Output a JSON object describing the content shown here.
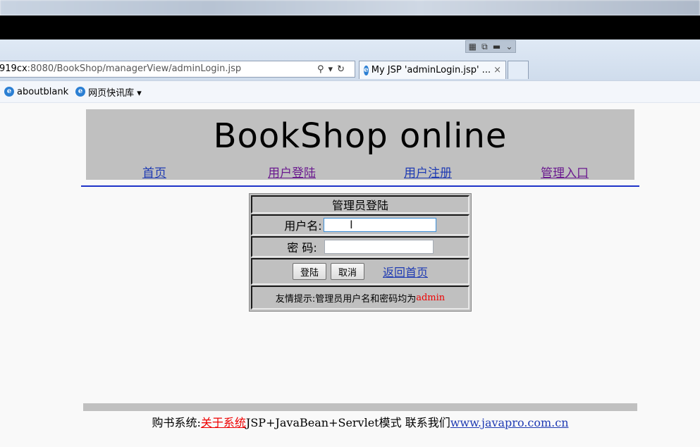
{
  "browser": {
    "address": "919cx:8080/BookShop/managerView/adminLogin.jsp",
    "address_host": "919cx",
    "address_rest": ":8080/BookShop/managerView/adminLogin.jsp",
    "tab_title": "My JSP 'adminLogin.jsp' ...",
    "tab_close": "×",
    "search_glyph": "⚲",
    "refresh_glyph": "↻",
    "favorites": [
      {
        "label": "aboutblank"
      },
      {
        "label": "网页快讯库 ▾"
      }
    ]
  },
  "site": {
    "title": "BookShop online",
    "nav": [
      {
        "label": "首页"
      },
      {
        "label": "用户登陆"
      },
      {
        "label": "用户注册"
      },
      {
        "label": "管理入口"
      }
    ]
  },
  "login": {
    "heading": "管理员登陆",
    "username_label": "用户名:",
    "username_value": "",
    "password_label": "密 码:",
    "password_value": "",
    "submit_label": "登陆",
    "cancel_label": "取消",
    "back_label": "返回首页",
    "tip_prefix": "友情提示:管理员用户名和密码均为",
    "tip_value": "admin"
  },
  "footer": {
    "prefix": "购书系统:",
    "about": "关于系统",
    "middle": "JSP+JavaBean+Servlet模式 联系我们",
    "url": "www.javapro.com.cn"
  },
  "colors": {
    "header_bg": "#c0c0c0",
    "rule_blue": "#1f34c8",
    "link_blue": "#1f3bb3",
    "highlight_red": "#ee0000"
  }
}
